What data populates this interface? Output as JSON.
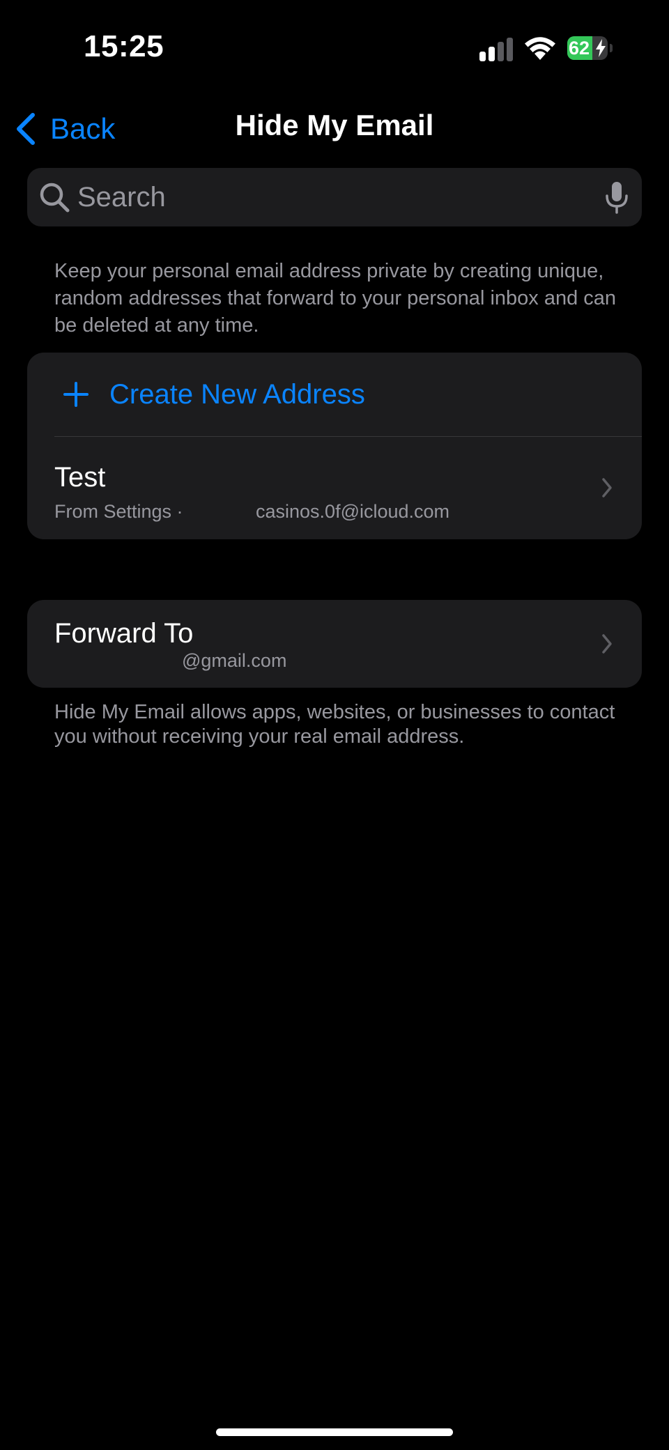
{
  "status_bar": {
    "time": "15:25",
    "battery_level": "62",
    "battery_fraction": 0.62,
    "icons": [
      "signal-icon",
      "wifi-icon",
      "battery-icon",
      "charging-bolt-icon"
    ]
  },
  "nav": {
    "back_label": "Back",
    "title": "Hide My Email"
  },
  "search": {
    "placeholder": "Search",
    "value": ""
  },
  "description": "Keep your personal email address private by creating unique, random addresses that forward to your personal inbox and can be deleted at any time.",
  "addresses": {
    "create_label": "Create New Address",
    "items": [
      {
        "title": "Test",
        "source": "From Settings ·",
        "email": "casinos.0f@icloud.com"
      }
    ]
  },
  "forward": {
    "title": "Forward To",
    "email": "@gmail.com"
  },
  "footer": "Hide My Email allows apps, websites, or businesses to contact you without receiving your real email address.",
  "colors": {
    "accent": "#0a84ff",
    "background": "#000000",
    "card": "#1c1c1e",
    "secondary_text": "#98989f",
    "battery_green": "#34c759"
  }
}
